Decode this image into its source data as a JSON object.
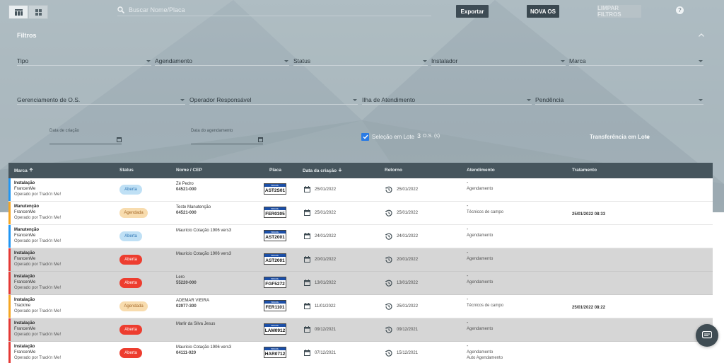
{
  "search": {
    "placeholder": "Buscar Nome/Placa"
  },
  "toolbar": {
    "export_label": "Exportar",
    "new_label": "NOVA OS",
    "clear_label": "LIMPAR FILTROS"
  },
  "filters": {
    "title": "Filtros",
    "row1": [
      "Tipo",
      "Agendamento",
      "Status",
      "Instalador",
      "Marca"
    ],
    "row2": [
      "Gerenciamento de O.S.",
      "Operador Responsável",
      "Ilha de Atendimento",
      "Pendência"
    ],
    "date_created_label": "Data de criação",
    "date_scheduled_label": "Data do agendamento",
    "batch_label": "Seleção em Lote",
    "batch_count": "3",
    "batch_unit": "O.S. (s)",
    "transfer_label": "Transferência em Lote"
  },
  "table": {
    "headers": {
      "brand": "Marca",
      "status": "Status",
      "name": "Nome / CEP",
      "plate": "Placa",
      "created": "Data da criação",
      "return": "Retorno",
      "service": "Atendimento",
      "treatment": "Tratamento"
    },
    "rows": [
      {
        "type": "Instalação",
        "client": "FrancenMe",
        "operator": "Operado por Track'n Me!",
        "status": "Aberta",
        "name": "Zé Pedro",
        "cep": "04521-000",
        "plate_country": "BRASIL",
        "plate": "AST2S01",
        "created": "25/01/2022",
        "return": "25/01/2022",
        "service_dash": "-",
        "service1": "Agendamento",
        "service2": "",
        "treatment": ""
      },
      {
        "type": "Manutenção",
        "client": "FrancenMe",
        "operator": "Operado por Track'n Me!",
        "status": "Agendada",
        "name": "Teste Manutenção",
        "cep": "04521-000",
        "plate_country": "BRASIL",
        "plate": "FER0305",
        "created": "25/01/2022",
        "return": "25/01/2022",
        "service_dash": "-",
        "service1": "Técnicos de campo",
        "service2": "",
        "treatment": "25/01/2022 08:33"
      },
      {
        "type": "Manutenção",
        "client": "FrancenMe",
        "operator": "Operado por Track'n Me!",
        "status": "Aberta",
        "name": "Mauricio Cotação 1906 vers3",
        "cep": "",
        "plate_country": "BRASIL",
        "plate": "AST2001",
        "created": "24/01/2022",
        "return": "24/01/2022",
        "service_dash": "-",
        "service1": "Agendamento",
        "service2": "",
        "treatment": ""
      },
      {
        "type": "Instalação",
        "client": "FrancenMe",
        "operator": "Operado por Track'n Me!",
        "status": "Aberta",
        "name": "Mauricio Cotação 1906 vers3",
        "cep": "",
        "plate_country": "BRASIL",
        "plate": "AST2001",
        "created": "20/01/2022",
        "return": "20/01/2022",
        "service_dash": "-",
        "service1": "Agendamento",
        "service2": "",
        "treatment": ""
      },
      {
        "type": "Instalação",
        "client": "FrancenMe",
        "operator": "Operado por Track'n Me!",
        "status": "Aberta",
        "name": "Lero",
        "cep": "55220-000",
        "plate_country": "BRASIL",
        "plate": "FGF5272",
        "created": "13/01/2022",
        "return": "13/01/2022",
        "service_dash": "-",
        "service1": "Agendamento",
        "service2": "",
        "treatment": ""
      },
      {
        "type": "Instalação",
        "client": "Trackme",
        "operator": "Operado por Track'n Me!",
        "status": "Agendada",
        "name": "ADEMAR VIEIRA",
        "cep": "02977-300",
        "plate_country": "BRASIL",
        "plate": "FER1101",
        "created": "11/01/2022",
        "return": "25/01/2022",
        "service_dash": "-",
        "service1": "Técnicos de campo",
        "service2": "",
        "treatment": "25/01/2022 08:22"
      },
      {
        "type": "Instalação",
        "client": "FrancenMe",
        "operator": "Operado por Track'n Me!",
        "status": "Aberta",
        "name": "Marlir da Silva Jesus",
        "cep": "",
        "plate_country": "BRASIL",
        "plate": "LAM0912",
        "created": "09/12/2021",
        "return": "09/12/2021",
        "service_dash": "-",
        "service1": "Agendamento",
        "service2": "",
        "treatment": ""
      },
      {
        "type": "Instalação",
        "client": "FrancenMe",
        "operator": "Operado por Track'n Me!",
        "status": "Aberta",
        "name": "Mauricio Cotação 1906 vers3",
        "cep": "04111-020",
        "plate_country": "BRASIL",
        "plate": "HAR0712",
        "created": "07/12/2021",
        "return": "15/12/2021",
        "service_dash": "-",
        "service1": "Agendamento",
        "service2": "Auto Agendamento",
        "treatment": ""
      }
    ]
  },
  "colors": {
    "header_bg": "#46555d",
    "install_bar": "#e53935",
    "maintenance_bar": "#f5a623",
    "open_install_bar": "#2196f3",
    "late_pill": "#ed3d2f",
    "open_pill": "#bfe0f5",
    "scheduled_pill": "#f8dcae",
    "checkbox": "#2a7be4"
  }
}
